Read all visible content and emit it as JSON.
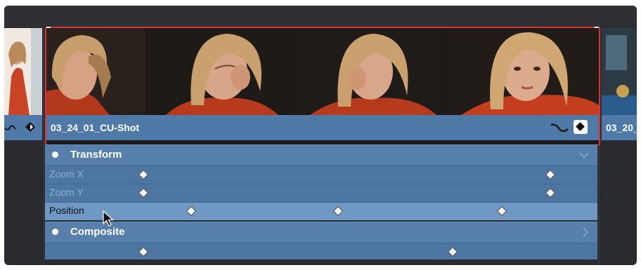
{
  "clip": {
    "name": "03_24_01_CU-Shot",
    "next_clip_name": "03_20_"
  },
  "transform": {
    "title": "Transform",
    "rows": [
      {
        "label": "Zoom X"
      },
      {
        "label": "Zoom Y"
      },
      {
        "label": "Position"
      }
    ]
  },
  "composite": {
    "title": "Composite"
  },
  "icons": {
    "curve": "curve-icon",
    "keyframe": "keyframe-icon",
    "collapse": "chevron-down-icon",
    "expand": "chevron-right-icon",
    "cursor": "mouse-cursor-icon"
  },
  "colors": {
    "selection_border": "#d73535",
    "clip_bar": "#4f79a6",
    "panel_bg": "#4e76a2",
    "highlight_row": "#6f99c4",
    "inactive_label": "#8fb1d3"
  }
}
